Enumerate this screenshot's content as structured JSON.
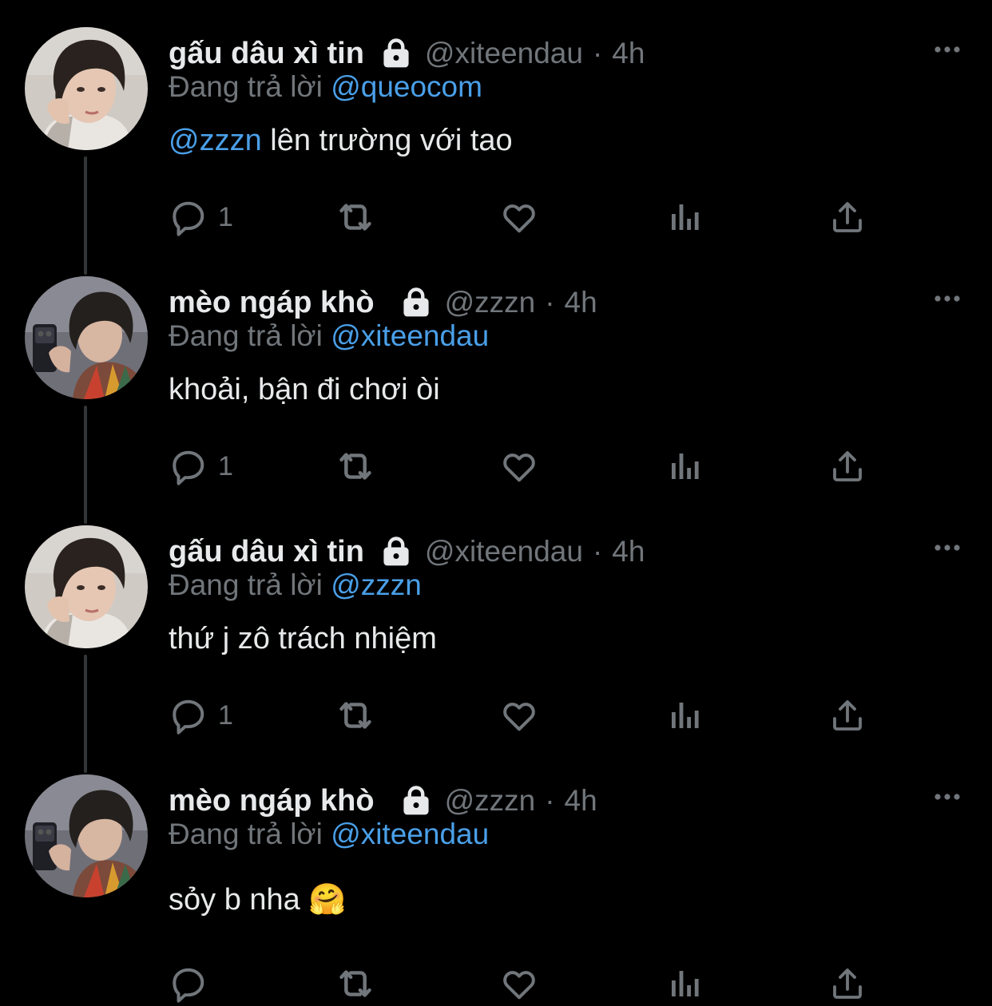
{
  "reply_prefix": "Đang trả lời",
  "tweets": [
    {
      "display_name": "gấu dâu xì tin",
      "handle": "@xiteendau",
      "separator": "·",
      "time": "4h",
      "reply_to": "@queocom",
      "body_mention": "@zzzn",
      "body_text": " lên trường với tao",
      "reply_count": "1",
      "avatar": "avatar-a"
    },
    {
      "display_name": "mèo ngáp khò",
      "handle": "@zzzn",
      "separator": "·",
      "time": "4h",
      "reply_to": "@xiteendau",
      "body_mention": "",
      "body_text": "khoải, bận đi chơi òi",
      "reply_count": "1",
      "avatar": "avatar-b"
    },
    {
      "display_name": "gấu dâu xì tin",
      "handle": "@xiteendau",
      "separator": "·",
      "time": "4h",
      "reply_to": "@zzzn",
      "body_mention": "",
      "body_text": "thứ j zô trách nhiệm",
      "reply_count": "1",
      "avatar": "avatar-a"
    },
    {
      "display_name": "mèo ngáp khò",
      "handle": "@zzzn",
      "separator": "·",
      "time": "4h",
      "reply_to": "@xiteendau",
      "body_mention": "",
      "body_text": "sỏy b nha ",
      "body_emoji": "🤗",
      "reply_count": "",
      "avatar": "avatar-b"
    }
  ],
  "icons": {
    "reply": "reply-icon",
    "retweet": "retweet-icon",
    "like": "like-icon",
    "views": "views-icon",
    "share": "share-icon",
    "more": "more-icon",
    "lock": "lock-icon"
  },
  "colors": {
    "background": "#000000",
    "primary_text": "#e7e9ea",
    "secondary_text": "#71767b",
    "mention": "#4a9fe8",
    "thread_line": "#333639"
  }
}
